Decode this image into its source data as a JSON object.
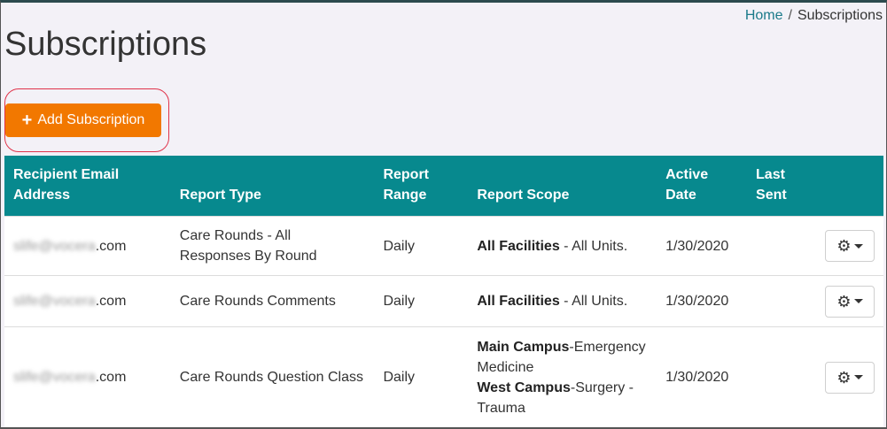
{
  "breadcrumb": {
    "home": "Home",
    "separator": "/",
    "current": "Subscriptions"
  },
  "page_title": "Subscriptions",
  "add_button": {
    "icon": "plus-icon",
    "label": "Add Subscription"
  },
  "colors": {
    "header_bg": "#07898e",
    "add_button_bg": "#f27800",
    "highlight_ring": "#e0334a"
  },
  "table": {
    "headers": {
      "recipient": [
        "Recipient Email",
        "Address"
      ],
      "report_type": "Report Type",
      "report_range": [
        "Report",
        "Range"
      ],
      "report_scope": "Report Scope",
      "active_date": [
        "Active",
        "Date"
      ],
      "last_sent": [
        "Last",
        "Sent"
      ]
    },
    "rows": [
      {
        "email_hidden": "slife@vocera",
        "email_domain": ".com",
        "report_type": "Care Rounds - All Responses By Round",
        "report_range": "Daily",
        "scope": [
          {
            "bold": "All Facilities",
            "rest": " - All Units."
          }
        ],
        "active_date": "1/30/2020",
        "last_sent": "",
        "action_icon": "gear-icon"
      },
      {
        "email_hidden": "slife@vocera",
        "email_domain": ".com",
        "report_type": "Care Rounds Comments",
        "report_range": "Daily",
        "scope": [
          {
            "bold": "All Facilities",
            "rest": " - All Units."
          }
        ],
        "active_date": "1/30/2020",
        "last_sent": "",
        "action_icon": "gear-icon"
      },
      {
        "email_hidden": "slife@vocera",
        "email_domain": ".com",
        "report_type": "Care Rounds Question Class",
        "report_range": "Daily",
        "scope": [
          {
            "bold": "Main Campus",
            "rest": "-Emergency Medicine"
          },
          {
            "bold": "West Campus",
            "rest": "-Surgery - Trauma"
          }
        ],
        "active_date": "1/30/2020",
        "last_sent": "",
        "action_icon": "gear-icon"
      }
    ]
  }
}
